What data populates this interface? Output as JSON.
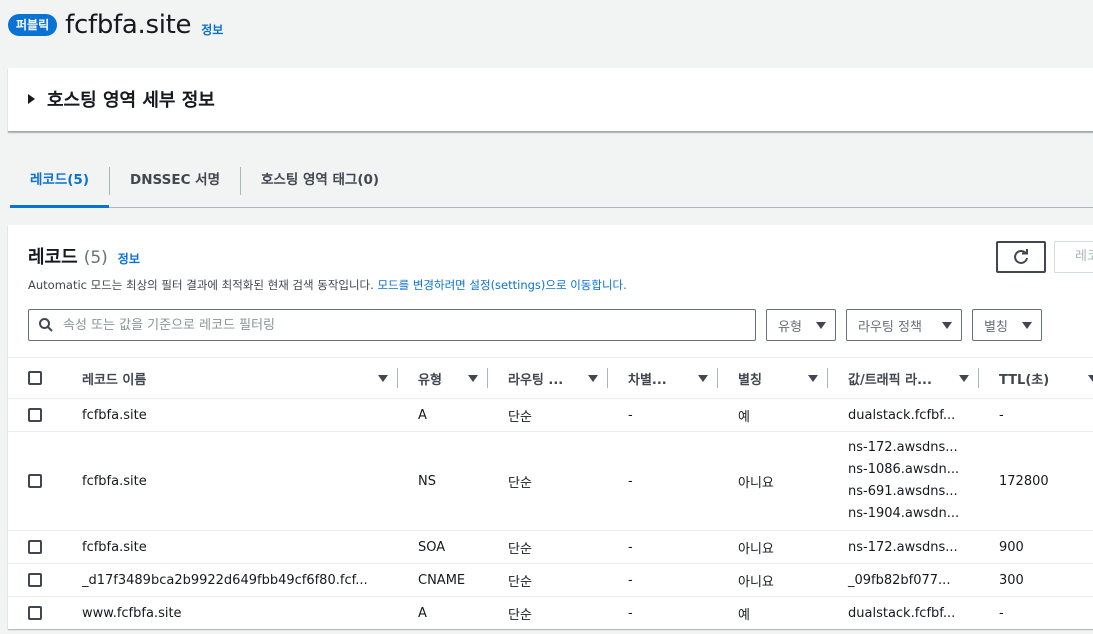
{
  "header": {
    "badge": "퍼블릭",
    "zone_name": "fcfbfa.site",
    "info": "정보"
  },
  "details": {
    "title": "호스팅 영역 세부 정보"
  },
  "tabs": [
    {
      "label": "레코드(5)"
    },
    {
      "label": "DNSSEC 서명"
    },
    {
      "label": "호스팅 영역 태그(0)"
    }
  ],
  "records": {
    "title": "레코드",
    "count": "(5)",
    "info": "정보",
    "desc_prefix": "Automatic 모드는 최상의 필터 결과에 최적화된 현재 검색 동작입니다.",
    "desc_link": "모드를 변경하려면 설정(settings)으로 이동합니다.",
    "cut_button": "레코",
    "search_placeholder": "속성 또는 값을 기준으로 레코드 필터링",
    "filters": [
      "유형",
      "라우팅 정책",
      "별칭"
    ]
  },
  "table": {
    "headers": [
      "레코드 이름",
      "유형",
      "라우팅 ...",
      "차별...",
      "별칭",
      "값/트래픽 라...",
      "TTL(초)"
    ],
    "rows": [
      {
        "name": "fcfbfa.site",
        "type": "A",
        "routing": "단순",
        "diff": "-",
        "alias": "예",
        "values": [
          "dualstack.fcfbf..."
        ],
        "ttl": "-"
      },
      {
        "name": "fcfbfa.site",
        "type": "NS",
        "routing": "단순",
        "diff": "-",
        "alias": "아니요",
        "values": [
          "ns-172.awsdns...",
          "ns-1086.awsdn...",
          "ns-691.awsdns...",
          "ns-1904.awsdn..."
        ],
        "ttl": "172800"
      },
      {
        "name": "fcfbfa.site",
        "type": "SOA",
        "routing": "단순",
        "diff": "-",
        "alias": "아니요",
        "values": [
          "ns-172.awsdns..."
        ],
        "ttl": "900"
      },
      {
        "name": "_d17f3489bca2b9922d649fbb49cf6f80.fcf...",
        "type": "CNAME",
        "routing": "단순",
        "diff": "-",
        "alias": "아니요",
        "values": [
          "_09fb82bf077..."
        ],
        "ttl": "300"
      },
      {
        "name": "www.fcfbfa.site",
        "type": "A",
        "routing": "단순",
        "diff": "-",
        "alias": "예",
        "values": [
          "dualstack.fcfbf..."
        ],
        "ttl": "-"
      }
    ]
  }
}
